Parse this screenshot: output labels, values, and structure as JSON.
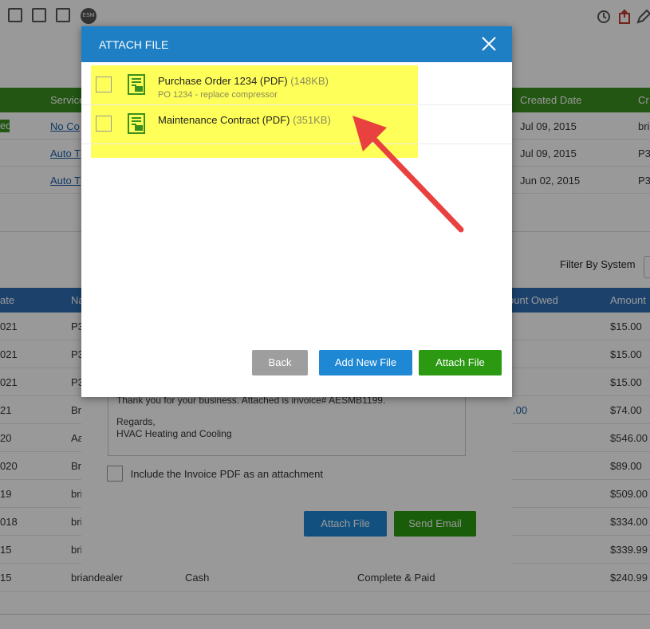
{
  "background": {
    "services_table": {
      "headers": [
        "Service",
        "Created Date",
        "Cr"
      ],
      "rows": [
        {
          "service": "No Co",
          "date": "Jul 09, 2015",
          "creator": "bri",
          "badge": "ed"
        },
        {
          "service": "Auto T",
          "date": "Jul 09, 2015",
          "creator": "P3"
        },
        {
          "service": "Auto T",
          "date": "Jun 02, 2015",
          "creator": "P3"
        }
      ]
    },
    "filter_label": "Filter By System",
    "invoices_table": {
      "headers": [
        "ate",
        "Na",
        "ount Owed",
        "Amount"
      ],
      "rows": [
        {
          "date": "021",
          "name": "P3",
          "amount": "$15.00"
        },
        {
          "date": "021",
          "name": "P3",
          "amount": "$15.00"
        },
        {
          "date": "021",
          "name": "P3",
          "amount": "$15.00"
        },
        {
          "date": "21",
          "name": "Bri",
          "owed": ".00",
          "amount": "$74.00"
        },
        {
          "date": "20",
          "name": "Aa",
          "amount": "$546.00"
        },
        {
          "date": "020",
          "name": "Br",
          "amount": "$89.00"
        },
        {
          "date": "19",
          "name": "bri",
          "amount": "$509.00"
        },
        {
          "date": "018",
          "name": "bri",
          "amount": "$334.00"
        },
        {
          "date": "15",
          "name": "bri",
          "amount": "$339.99"
        },
        {
          "date": "15",
          "name": "briandealer",
          "method": "Cash",
          "status": "Complete & Paid",
          "amount": "$240.99"
        }
      ]
    },
    "toolbar_esm": "ESM"
  },
  "email_dialog": {
    "body_line1": "Thank you for your business.  Attached is invoice# AESMB1199.",
    "body_line2": "Regards,",
    "body_line3": "HVAC Heating and Cooling",
    "include_pdf_label": "Include the Invoice PDF as an attachment",
    "attach_file_label": "Attach File",
    "send_email_label": "Send Email"
  },
  "attach_dialog": {
    "title": "ATTACH FILE",
    "files": [
      {
        "name": "Purchase Order 1234 (PDF)",
        "size": "(148KB)",
        "description": "PO 1234 - replace compressor"
      },
      {
        "name": "Maintenance Contract (PDF)",
        "size": "(351KB)",
        "description": ""
      }
    ],
    "back_label": "Back",
    "add_new_label": "Add New File",
    "attach_label": "Attach File"
  },
  "colors": {
    "title_bar": "#1f7fc4",
    "back_button": "#9e9e9e",
    "add_button": "#1f88d4",
    "attach_button": "#2b9a12",
    "highlight": "#ffff00",
    "arrow": "#e8413f"
  }
}
